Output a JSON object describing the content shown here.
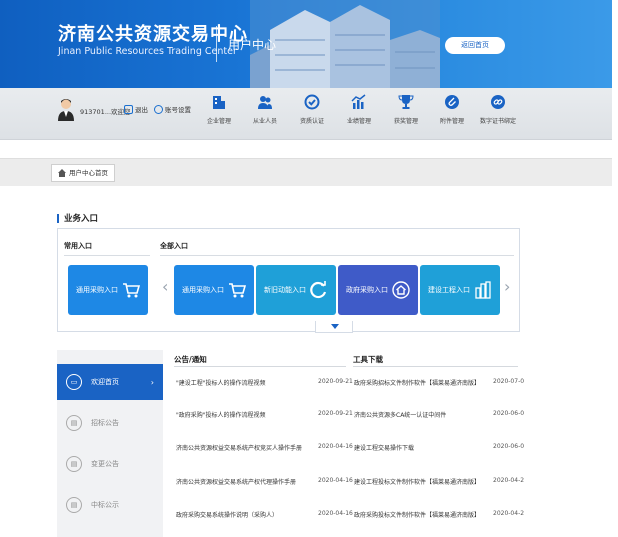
{
  "header": {
    "brand_cn": "济南公共资源交易中心",
    "brand_en": "Jinan Public Resources Trading Center",
    "title": "用户中心",
    "back_label": "返回首页"
  },
  "toolbar": {
    "user": "913701...欢迎您",
    "logout": "退出",
    "account": "账号设置",
    "nav": [
      {
        "label": "企业管理",
        "icon": "building-icon"
      },
      {
        "label": "从业人员",
        "icon": "users-icon"
      },
      {
        "label": "资质认证",
        "icon": "badge-icon"
      },
      {
        "label": "业绩管理",
        "icon": "chart-icon"
      },
      {
        "label": "获奖管理",
        "icon": "trophy-icon"
      },
      {
        "label": "附件管理",
        "icon": "paperclip-icon"
      },
      {
        "label": "数字证书绑定",
        "icon": "link-icon"
      }
    ]
  },
  "breadcrumb": {
    "label": "用户中心首页"
  },
  "section": {
    "title": "业务入口"
  },
  "entries": {
    "common_label": "常用入口",
    "all_label": "全部入口",
    "common": [
      {
        "label": "通用采购入口",
        "icon": "cart-icon"
      }
    ],
    "all": [
      {
        "label": "通用采购入口",
        "icon": "cart-icon"
      },
      {
        "label": "新旧动能入口",
        "icon": "refresh-icon"
      },
      {
        "label": "政府采购入口",
        "icon": "house-icon"
      },
      {
        "label": "建设工程入口",
        "icon": "buildings-icon"
      }
    ]
  },
  "sidebar": {
    "items": [
      {
        "label": "欢迎首页",
        "active": true
      },
      {
        "label": "招标公告",
        "active": false
      },
      {
        "label": "变更公告",
        "active": false
      },
      {
        "label": "中标公示",
        "active": false
      }
    ]
  },
  "notices": {
    "heading": "公告/通知",
    "rows": [
      {
        "title": "\"建设工程\"投标人的操作流程视频",
        "date": "2020-09-21"
      },
      {
        "title": "\"政府采购\"投标人的操作流程视频",
        "date": "2020-09-21"
      },
      {
        "title": "济南公共资源权益交易系统产权竞买人操作手册",
        "date": "2020-04-16"
      },
      {
        "title": "济南公共资源权益交易系统产权代理操作手册",
        "date": "2020-04-16"
      },
      {
        "title": "政府采购交易系统操作说明（采购人）",
        "date": "2020-04-16"
      }
    ]
  },
  "tools": {
    "heading": "工具下载",
    "rows": [
      {
        "title": "政府采购招标文件制作软件【福莱易通济南版】",
        "date": "2020-07-0"
      },
      {
        "title": "济南公共资源多CA统一认证中间件",
        "date": "2020-06-0"
      },
      {
        "title": "建设工程交易操作下载",
        "date": "2020-06-0"
      },
      {
        "title": "建设工程投标文件制作软件【福莱易通济南版】",
        "date": "2020-04-2"
      },
      {
        "title": "政府采购投标文件制作软件【福莱易通济南版】",
        "date": "2020-04-2"
      }
    ]
  },
  "colors": {
    "primary": "#1a63c4",
    "tile_blue": "#1e88e5",
    "tile_cyan": "#1fa0d8",
    "tile_navy": "#3f5bc8"
  }
}
